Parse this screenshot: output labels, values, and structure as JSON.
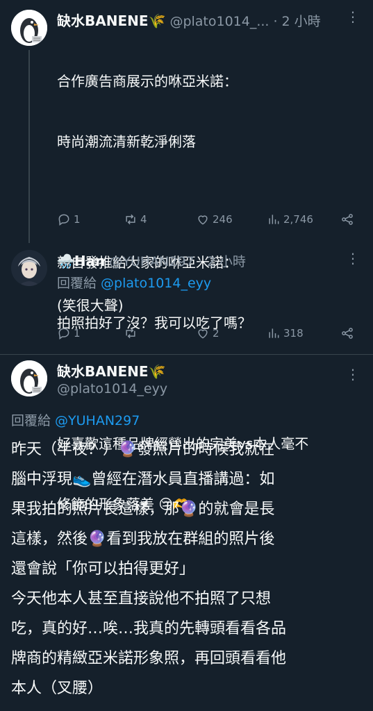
{
  "tweet1": {
    "name": "缺水BANENE🌾",
    "handle": "@plato1014_...",
    "time": "· 2 小時",
    "lines": [
      "合作廣告商展示的咻亞米諾：",
      "時尚潮流清新乾淨俐落",
      "",
      "親自發推給大家的咻亞米諾：",
      "拍照拍好了沒？我可以吃了嗎？",
      "",
      "好喜歡這種品牌經營出的完美vs本人毫不",
      "修飾的形象落差 😔🫶"
    ],
    "replies": "1",
    "retweets": "4",
    "likes": "246",
    "views": "2,746"
  },
  "tweet2": {
    "name": "🌧️Han",
    "handle": "@YUHAN297",
    "time": "· 2 小時",
    "reply_prefix": "回覆給 ",
    "reply_to": "@plato1014_eyy",
    "text": "(笑很大聲)",
    "replies": "1",
    "retweets": "",
    "likes": "2",
    "views": "318"
  },
  "tweet3": {
    "name": "缺水BANENE🌾",
    "handle": "@plato1014_eyy",
    "reply_prefix": "回覆給 ",
    "reply_to": "@YUHAN297",
    "lines": [
      "昨天（半夜？）🔮發照片的時候我就在",
      "腦中浮現👟曾經在潛水員直播講過：如",
      "果我拍的照片長這樣，那🔮的就會是長",
      "這樣，然後🔮看到我放在群組的照片後",
      "還會說「你可以拍得更好」",
      "今天他本人甚至直接說他不拍照了只想",
      "吃，真的好…唉…我真的先轉頭看看各品",
      "牌商的精緻亞米諾形象照，再回頭看看他",
      "本人（叉腰）"
    ]
  },
  "icons": {
    "reply": "reply-icon",
    "retweet": "retweet-icon",
    "like": "heart-icon",
    "views": "views-icon",
    "share": "share-icon",
    "more": "more-icon"
  },
  "colors": {
    "background": "#15202b",
    "text": "#f7f9f9",
    "secondary": "#8b98a5",
    "link": "#1d9bf0"
  }
}
